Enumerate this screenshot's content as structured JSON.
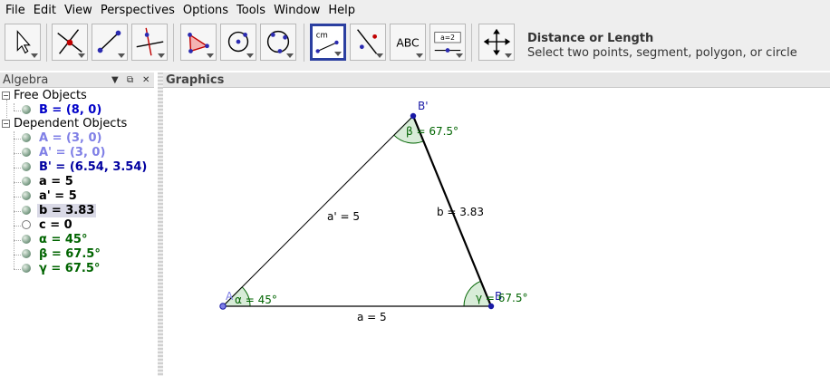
{
  "menu": [
    "File",
    "Edit",
    "View",
    "Perspectives",
    "Options",
    "Tools",
    "Window",
    "Help"
  ],
  "toolbar": {
    "help_title": "Distance or Length",
    "help_desc": "Select two points, segment, polygon, or circle",
    "text_tool_label": "ABC",
    "slider_tool_label": "a=2",
    "distance_tool_label": "cm"
  },
  "algebra": {
    "title": "Algebra",
    "free_label": "Free Objects",
    "dependent_label": "Dependent Objects",
    "free": [
      {
        "text": "B = (8, 0)",
        "color": "#0000c8",
        "hollow": false,
        "selected": false
      }
    ],
    "dependent": [
      {
        "text": "A = (3, 0)",
        "color": "#7f7fe6",
        "hollow": false,
        "selected": false
      },
      {
        "text": "A' = (3, 0)",
        "color": "#7f7fe6",
        "hollow": false,
        "selected": false
      },
      {
        "text": "B' = (6.54, 3.54)",
        "color": "#0000a0",
        "hollow": false,
        "selected": false
      },
      {
        "text": "a = 5",
        "color": "#000000",
        "hollow": false,
        "selected": false
      },
      {
        "text": "a' = 5",
        "color": "#000000",
        "hollow": false,
        "selected": false
      },
      {
        "text": "b = 3.83",
        "color": "#000000",
        "hollow": false,
        "selected": true
      },
      {
        "text": "c = 0",
        "color": "#000000",
        "hollow": true,
        "selected": false
      },
      {
        "text": "α = 45°",
        "color": "#006400",
        "hollow": false,
        "selected": false
      },
      {
        "text": "β = 67.5°",
        "color": "#006400",
        "hollow": false,
        "selected": false
      },
      {
        "text": "γ = 67.5°",
        "color": "#006400",
        "hollow": false,
        "selected": false
      }
    ]
  },
  "graphics": {
    "title": "Graphics",
    "labels": {
      "A": "A",
      "B": "B",
      "Bp": "B'",
      "seg_a": "a = 5",
      "seg_ap": "a' = 5",
      "seg_b": "b = 3.83",
      "alpha": "α = 45°",
      "beta": "β = 67.5°",
      "gamma": "γ = 67.5°"
    }
  },
  "colors": {
    "point": "#1a1aa6",
    "angle": "#006400",
    "angle_fill": "#d8ecd8",
    "selection": "#2b3fa0"
  }
}
